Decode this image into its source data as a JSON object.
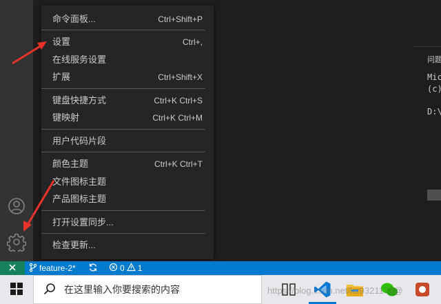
{
  "activity_bar": {
    "icons": [
      "account-icon",
      "gear-icon"
    ]
  },
  "menu": {
    "items": [
      {
        "label": "命令面板...",
        "shortcut": "Ctrl+Shift+P"
      },
      {
        "label": "设置",
        "shortcut": "Ctrl+,"
      },
      {
        "label": "在线服务设置",
        "shortcut": ""
      },
      {
        "label": "扩展",
        "shortcut": "Ctrl+Shift+X"
      },
      {
        "label": "键盘快捷方式",
        "shortcut": "Ctrl+K Ctrl+S"
      },
      {
        "label": "键映射",
        "shortcut": "Ctrl+K Ctrl+M"
      },
      {
        "label": "用户代码片段",
        "shortcut": ""
      },
      {
        "label": "颜色主题",
        "shortcut": "Ctrl+K Ctrl+T"
      },
      {
        "label": "文件图标主题",
        "shortcut": ""
      },
      {
        "label": "产品图标主题",
        "shortcut": ""
      },
      {
        "label": "打开设置同步...",
        "shortcut": ""
      },
      {
        "label": "检查更新...",
        "shortcut": ""
      }
    ]
  },
  "panel": {
    "tab": "问题",
    "terminal_lines": [
      "Mic",
      "(c)",
      "D:\\"
    ]
  },
  "status_bar": {
    "branch": "feature-2*",
    "errors": "0",
    "warnings": "1"
  },
  "taskbar": {
    "search_placeholder": "在这里输入你要搜索的内容"
  },
  "watermark": "https://blog.csdn.net/lcr9321173@",
  "colors": {
    "status_bar": "#007acc",
    "remote_indicator": "#16825d",
    "menu_bg": "#252526",
    "activity_bar": "#333333",
    "annotation_arrow": "#e8322a"
  }
}
